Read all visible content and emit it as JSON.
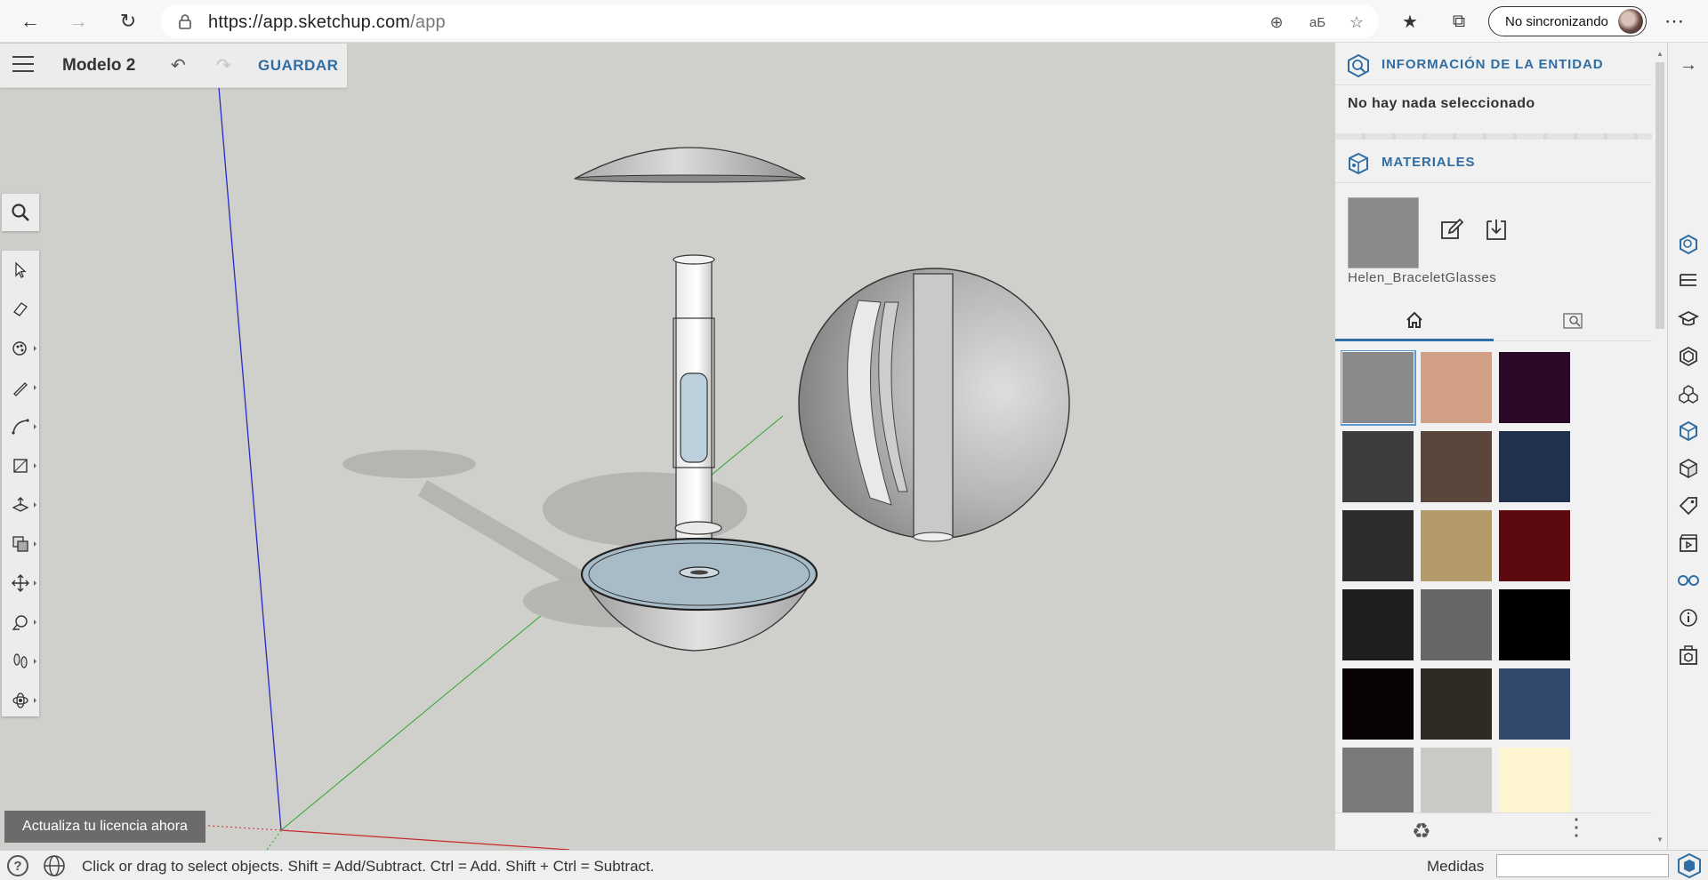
{
  "browser": {
    "url_host": "https://app.sketchup.com",
    "url_path": "/app",
    "profile_label": "No sincronizando"
  },
  "app": {
    "model_name": "Modelo 2",
    "save_label": "GUARDAR",
    "license_banner": "Actualiza tu licencia ahora"
  },
  "panel": {
    "entity_info_title": "INFORMACIÓN DE LA ENTIDAD",
    "entity_info_status": "No hay nada seleccionado",
    "materials_title": "MATERIALES",
    "current_material_name": "Helen_BraceletGlasses",
    "current_material_color": "#8a8a8a",
    "tabs": [
      {
        "icon": "home-icon",
        "active": true
      },
      {
        "icon": "material-search-icon",
        "active": false
      }
    ],
    "swatches": [
      "#8a8a8a",
      "#d2a087",
      "#2b0a28",
      "#3d3d3d",
      "#5b463c",
      "#213150",
      "#2c2c2c",
      "#b49a6a",
      "#5c0a10",
      "#1e1e1e",
      "#676767",
      "#000000",
      "#0a0306",
      "#2e2b25",
      "#344a6c",
      "#7a7a7a",
      "#cbc9c4",
      "#fff5d1"
    ]
  },
  "status": {
    "hint": "Click or drag to select objects. Shift = Add/Subtract. Ctrl = Add. Shift + Ctrl = Subtract.",
    "measurements_label": "Medidas",
    "measurements_value": ""
  },
  "colors": {
    "accent": "#2f6da3",
    "viewport_bg": "#cfcfcb"
  }
}
